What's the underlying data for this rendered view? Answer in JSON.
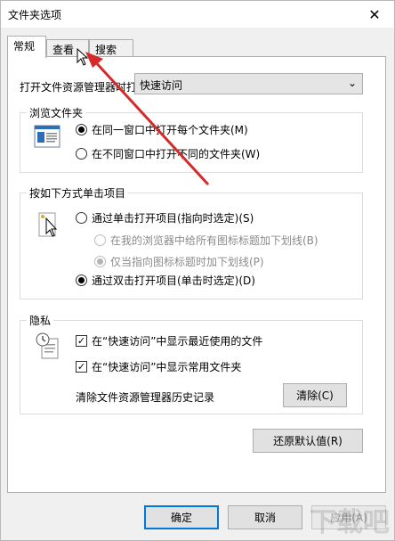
{
  "window": {
    "title": "文件夹选项",
    "close_icon": "close-icon"
  },
  "tabs": [
    {
      "label": "常规",
      "active": true
    },
    {
      "label": "查看",
      "active": false
    },
    {
      "label": "搜索",
      "active": false
    }
  ],
  "open_explorer": {
    "label": "打开文件资源管理器时打",
    "value": "快速访问"
  },
  "browse_folders": {
    "title": "浏览文件夹",
    "options": [
      {
        "label": "在同一窗口中打开每个文件夹(M)",
        "selected": true
      },
      {
        "label": "在不同窗口中打开不同的文件夹(W)",
        "selected": false
      }
    ]
  },
  "click_items": {
    "title": "按如下方式单击项目",
    "single": {
      "label": "通过单击打开项目(指向时选定)(S)",
      "selected": false
    },
    "sub_options": [
      {
        "label": "在我的浏览器中给所有图标标题加下划线(B)",
        "selected": false
      },
      {
        "label": "仅当指向图标标题时加下划线(P)",
        "selected": true
      }
    ],
    "double": {
      "label": "通过双击打开项目(单击时选定)(D)",
      "selected": true
    }
  },
  "privacy": {
    "title": "隐私",
    "checks": [
      {
        "label": "在“快速访问”中显示最近使用的文件",
        "checked": true
      },
      {
        "label": "在“快速访问”中显示常用文件夹",
        "checked": true
      }
    ],
    "clear_label": "清除文件资源管理器历史记录",
    "clear_button": "清除(C)"
  },
  "restore_defaults": "还原默认值(R)",
  "footer": {
    "ok": "确定",
    "cancel": "取消",
    "apply": "应用(A)"
  },
  "watermark": "下载吧"
}
